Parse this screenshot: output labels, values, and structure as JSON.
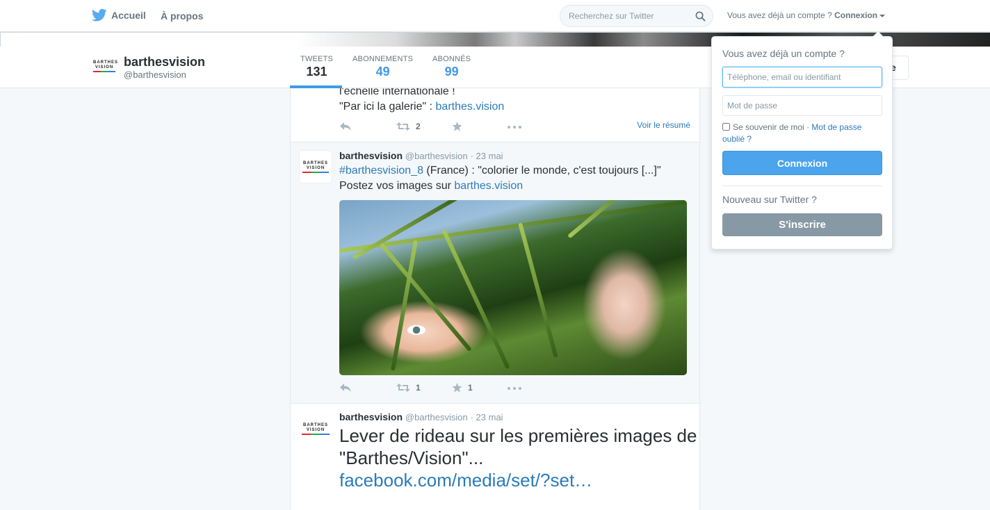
{
  "topnav": {
    "home_label": "Accueil",
    "about_label": "À propos",
    "search_placeholder": "Recherchez sur Twitter",
    "account_prompt": "Vous avez déjà un compte ?",
    "login_label": "Connexion"
  },
  "profile": {
    "name": "barthesvision",
    "handle": "@barthesvision",
    "logo_text": "BARTHES VISION",
    "stats": [
      {
        "label": "TWEETS",
        "value": "131"
      },
      {
        "label": "ABONNEMENTS",
        "value": "49"
      },
      {
        "label": "ABONNÉS",
        "value": "99"
      }
    ],
    "follow_partial": "e"
  },
  "tweets": [
    {
      "line1": "l'échelle internationale !",
      "line2_prefix": "\"Par ici la galerie\" : ",
      "line2_link": "barthes.vision",
      "retweets": "2",
      "summary_link": "Voir le résumé"
    },
    {
      "name": "barthesvision",
      "handle": "@barthesvision",
      "date": "· 23 mai",
      "hashtag": "#barthesvision_8",
      "text_after_hashtag": " (France) : \"colorier le monde, c'est toujours [...]\"",
      "line2_prefix": "Postez vos images sur ",
      "line2_link": "barthes.vision",
      "retweets": "1",
      "favorites": "1"
    },
    {
      "name": "barthesvision",
      "handle": "@barthesvision",
      "date": "· 23 mai",
      "text_line1": "Lever de rideau sur les premières images de",
      "text_line2": "\"Barthes/Vision\"...",
      "link": "facebook.com/media/set/?set…"
    }
  ],
  "login_dropdown": {
    "title": "Vous avez déjà un compte ?",
    "username_placeholder": "Téléphone, email ou identifiant",
    "password_placeholder": "Mot de passe",
    "remember_label": "Se souvenir de moi",
    "separator": " · ",
    "forgot_link": "Mot de passe oublié ?",
    "login_button": "Connexion",
    "new_prompt": "Nouveau sur Twitter ?",
    "signup_button": "S'inscrire"
  },
  "colors": {
    "accent": "#4099e6",
    "link": "#2b7bb9",
    "signup_button": "#8899a6",
    "login_button": "#4ba4ec"
  }
}
